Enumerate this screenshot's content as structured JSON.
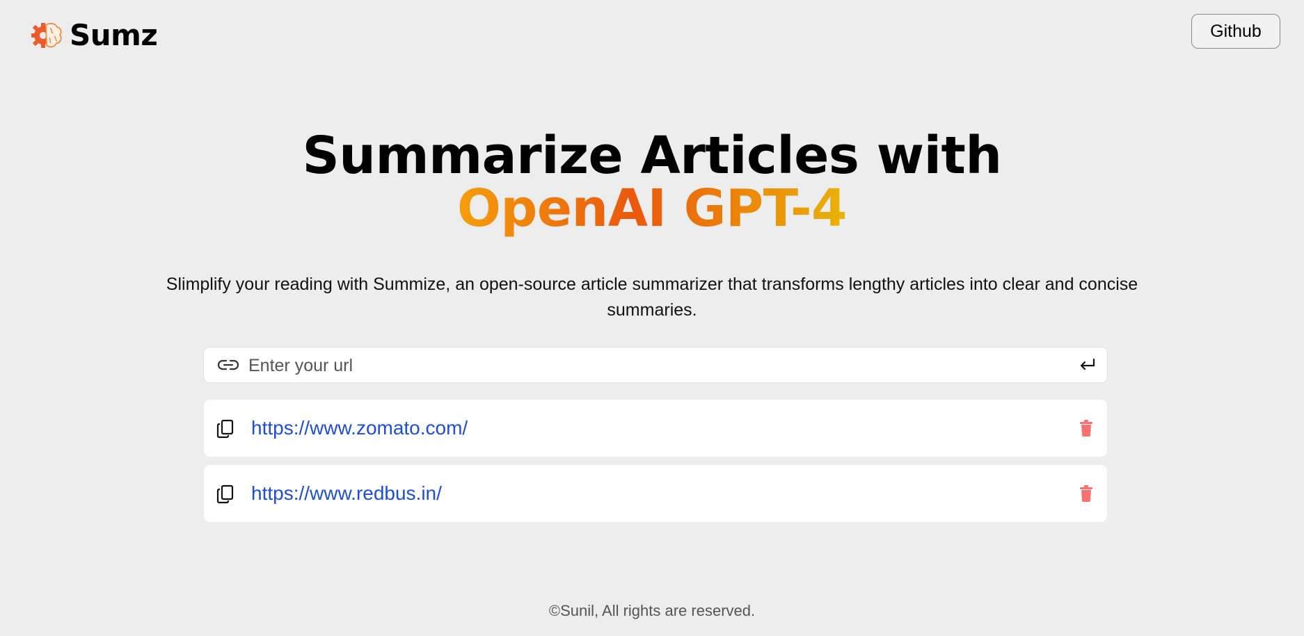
{
  "nav": {
    "logo_icon": "brain-gear-icon",
    "logo_text": "Sumz",
    "github_label": "Github"
  },
  "hero": {
    "title_line1": "Summarize Articles with",
    "title_line2": "OpenAI GPT-4",
    "description": "Slimplify your reading with Summize, an open-source article summarizer that transforms lengthy articles into clear and concise summaries."
  },
  "search": {
    "placeholder": "Enter your url",
    "value": "",
    "link_icon": "link-icon",
    "submit_icon": "enter-icon"
  },
  "history": [
    {
      "url": "https://www.zomato.com/",
      "copy_icon": "copy-icon",
      "delete_icon": "trash-icon"
    },
    {
      "url": "https://www.redbus.in/",
      "copy_icon": "copy-icon",
      "delete_icon": "trash-icon"
    }
  ],
  "footer": {
    "text": "©Sunil, All rights are reserved."
  },
  "colors": {
    "background": "#ededed",
    "accent_start": "#f59e0b",
    "accent_mid": "#ea580c",
    "accent_end": "#eab308",
    "link": "#1d4ed8",
    "delete": "#f87171"
  }
}
